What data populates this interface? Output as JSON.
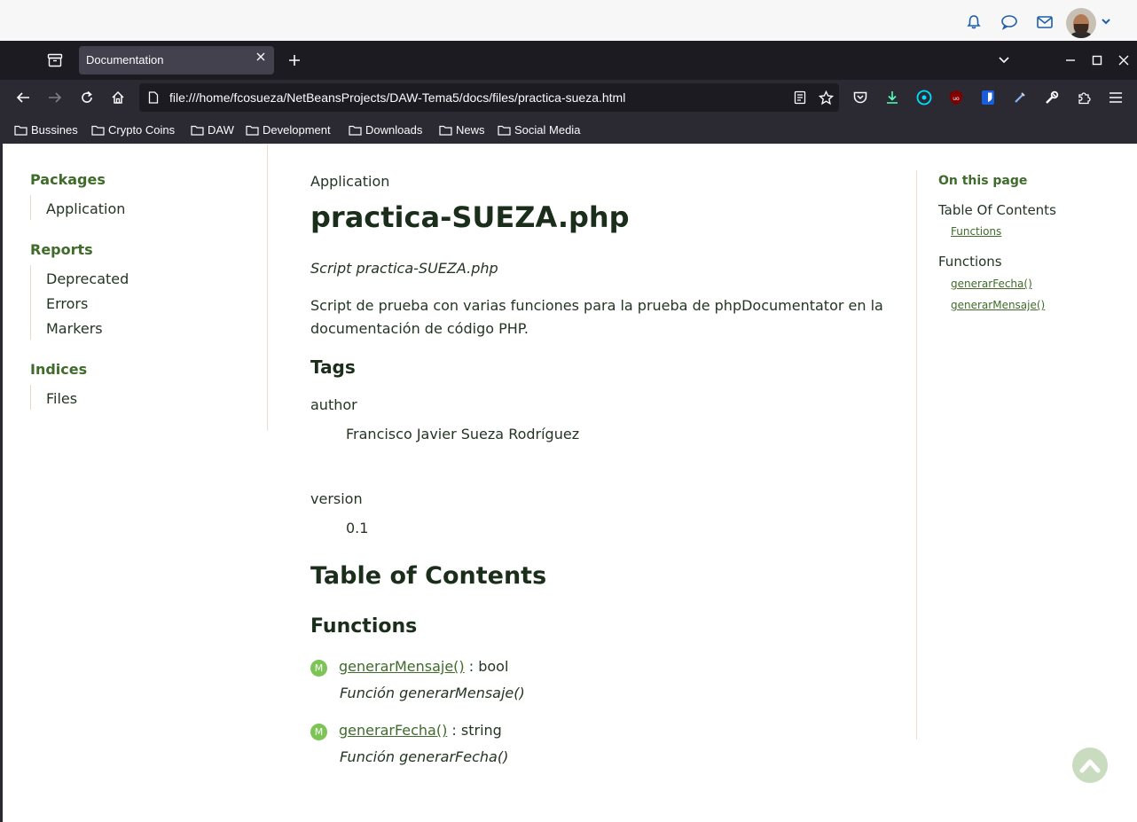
{
  "browser": {
    "tab_title": "Documentation",
    "url": "file:///home/fcosueza/NetBeansProjects/DAW-Tema5/docs/files/practica-sueza.html",
    "bookmarks": [
      "Bussines",
      "Crypto Coins",
      "DAW",
      "Development",
      "Downloads",
      "News",
      "Social Media"
    ]
  },
  "sidebar": {
    "packages_heading": "Packages",
    "packages": [
      "Application"
    ],
    "reports_heading": "Reports",
    "reports": [
      "Deprecated",
      "Errors",
      "Markers"
    ],
    "indices_heading": "Indices",
    "indices": [
      "Files"
    ]
  },
  "main": {
    "breadcrumb": "Application",
    "title": "practica-SUEZA.php",
    "summary": "Script practica-SUEZA.php",
    "description": "Script de prueba con varias funciones para la prueba de phpDocumentator en la documentación de código PHP.",
    "tags_heading": "Tags",
    "tags": [
      {
        "name": "author",
        "value": "Francisco Javier Sueza Rodríguez"
      },
      {
        "name": "version",
        "value": "0.1"
      }
    ],
    "toc_heading": "Table of Contents",
    "functions_heading": "Functions",
    "functions": [
      {
        "badge": "M",
        "name": "generarMensaje()",
        "returns": " : bool",
        "description": "Función generarMensaje()"
      },
      {
        "badge": "M",
        "name": "generarFecha()",
        "returns": " : string",
        "description": "Función generarFecha()"
      }
    ]
  },
  "on_this_page": {
    "title": "On this page",
    "toc_group": "Table Of Contents",
    "toc_links": [
      "Functions"
    ],
    "functions_group": "Functions",
    "function_links": [
      "generarFecha()",
      "generarMensaje()"
    ]
  }
}
